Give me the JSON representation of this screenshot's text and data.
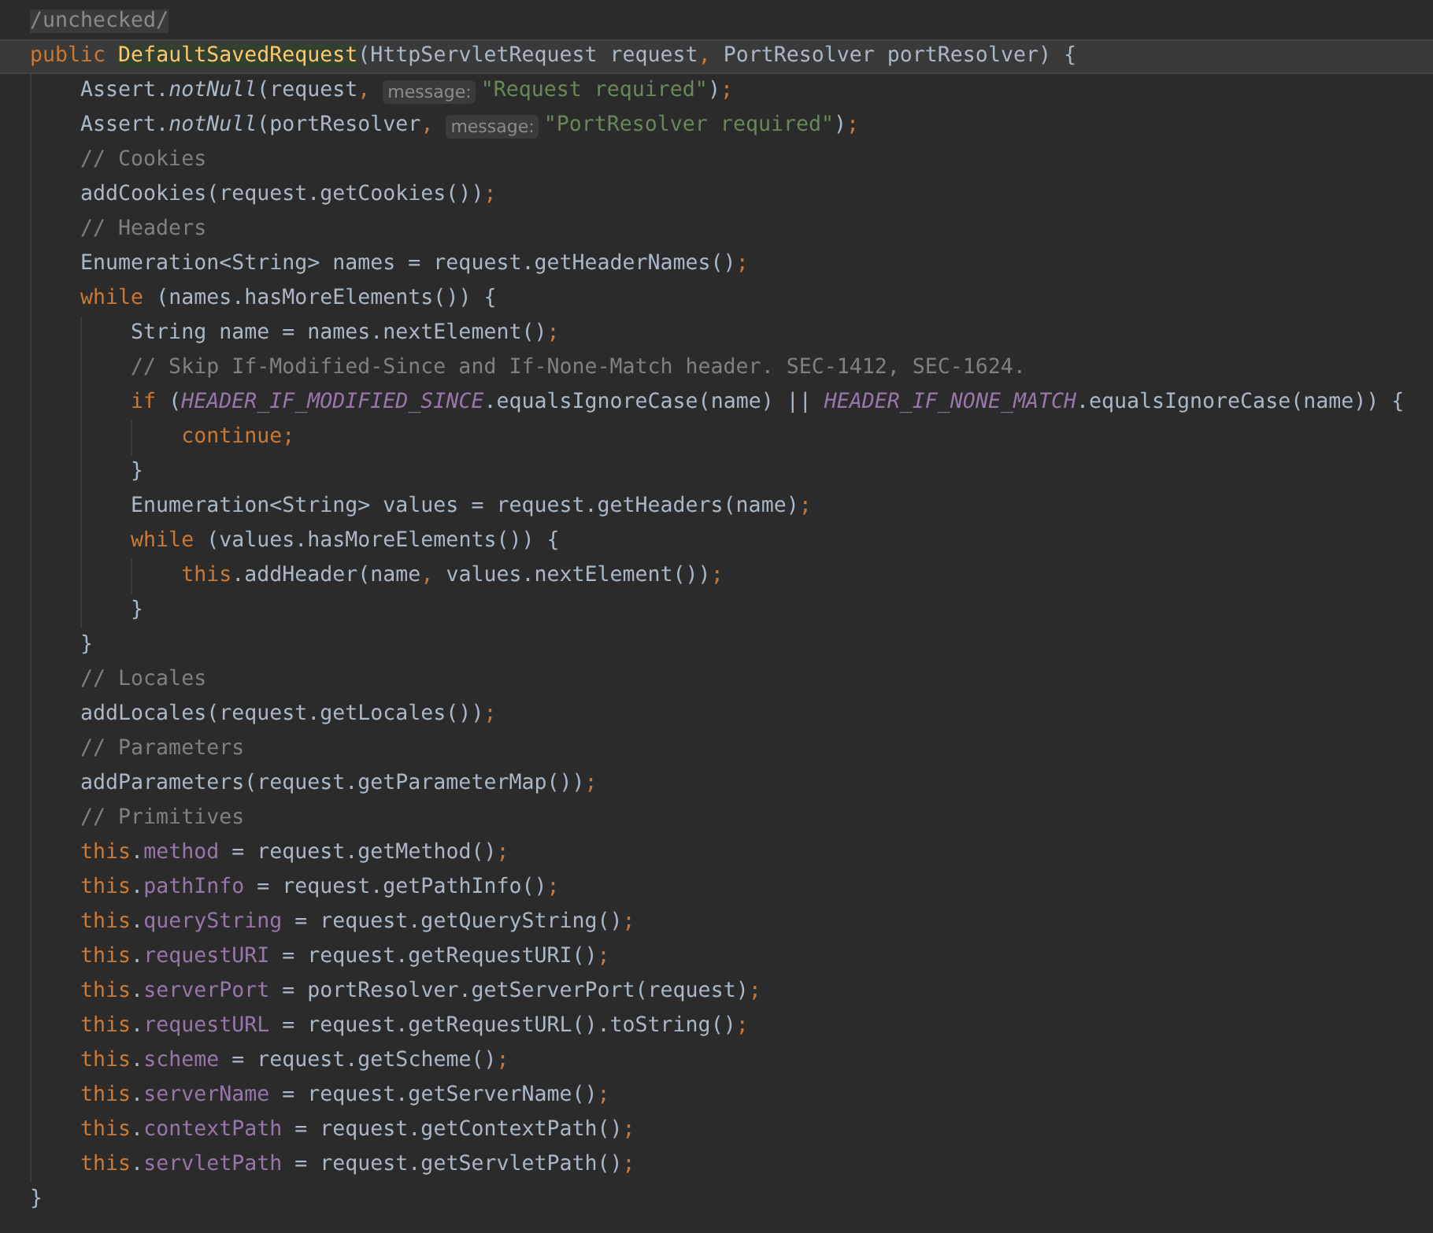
{
  "lines": [
    {
      "current": false,
      "tokens": [
        {
          "kind": "folded",
          "text": "/unchecked/"
        }
      ]
    },
    {
      "current": true,
      "tokens": [
        {
          "kind": "keyword",
          "text": "public "
        },
        {
          "kind": "declaration",
          "text": "DefaultSavedRequest"
        },
        {
          "kind": "plain",
          "text": "(HttpServletRequest request"
        },
        {
          "kind": "punct",
          "text": ", "
        },
        {
          "kind": "plain",
          "text": "PortResolver portResolver) {"
        }
      ]
    },
    {
      "current": false,
      "tokens": [
        {
          "kind": "plain",
          "text": "    Assert."
        },
        {
          "kind": "static_method",
          "text": "notNull"
        },
        {
          "kind": "plain",
          "text": "(request"
        },
        {
          "kind": "punct",
          "text": ", "
        },
        {
          "kind": "hint",
          "text": "message:"
        },
        {
          "kind": "string",
          "text": "\"Request required\""
        },
        {
          "kind": "plain",
          "text": ")"
        },
        {
          "kind": "punct",
          "text": ";"
        }
      ]
    },
    {
      "current": false,
      "tokens": [
        {
          "kind": "plain",
          "text": "    Assert."
        },
        {
          "kind": "static_method",
          "text": "notNull"
        },
        {
          "kind": "plain",
          "text": "(portResolver"
        },
        {
          "kind": "punct",
          "text": ", "
        },
        {
          "kind": "hint",
          "text": "message:"
        },
        {
          "kind": "string",
          "text": "\"PortResolver required\""
        },
        {
          "kind": "plain",
          "text": ")"
        },
        {
          "kind": "punct",
          "text": ";"
        }
      ]
    },
    {
      "current": false,
      "tokens": [
        {
          "kind": "comment",
          "text": "    // Cookies"
        }
      ]
    },
    {
      "current": false,
      "tokens": [
        {
          "kind": "plain",
          "text": "    addCookies(request.getCookies())"
        },
        {
          "kind": "punct",
          "text": ";"
        }
      ]
    },
    {
      "current": false,
      "tokens": [
        {
          "kind": "comment",
          "text": "    // Headers"
        }
      ]
    },
    {
      "current": false,
      "tokens": [
        {
          "kind": "plain",
          "text": "    Enumeration<String> names = request.getHeaderNames()"
        },
        {
          "kind": "punct",
          "text": ";"
        }
      ]
    },
    {
      "current": false,
      "tokens": [
        {
          "kind": "keyword",
          "text": "    while"
        },
        {
          "kind": "plain",
          "text": " (names.hasMoreElements()) {"
        }
      ]
    },
    {
      "current": false,
      "tokens": [
        {
          "kind": "plain",
          "text": "        String name = names.nextElement()"
        },
        {
          "kind": "punct",
          "text": ";"
        }
      ]
    },
    {
      "current": false,
      "tokens": [
        {
          "kind": "comment",
          "text": "        // Skip If-Modified-Since and If-None-Match header. SEC-1412, SEC-1624."
        }
      ]
    },
    {
      "current": false,
      "tokens": [
        {
          "kind": "keyword",
          "text": "        if"
        },
        {
          "kind": "plain",
          "text": " ("
        },
        {
          "kind": "static_field",
          "text": "HEADER_IF_MODIFIED_SINCE"
        },
        {
          "kind": "plain",
          "text": ".equalsIgnoreCase(name) || "
        },
        {
          "kind": "static_field",
          "text": "HEADER_IF_NONE_MATCH"
        },
        {
          "kind": "plain",
          "text": ".equalsIgnoreCase(name)) {"
        }
      ]
    },
    {
      "current": false,
      "tokens": [
        {
          "kind": "keyword",
          "text": "            continue"
        },
        {
          "kind": "punct",
          "text": ";"
        }
      ]
    },
    {
      "current": false,
      "tokens": [
        {
          "kind": "plain",
          "text": "        }"
        }
      ]
    },
    {
      "current": false,
      "tokens": [
        {
          "kind": "plain",
          "text": "        Enumeration<String> values = request.getHeaders(name)"
        },
        {
          "kind": "punct",
          "text": ";"
        }
      ]
    },
    {
      "current": false,
      "tokens": [
        {
          "kind": "keyword",
          "text": "        while"
        },
        {
          "kind": "plain",
          "text": " (values.hasMoreElements()) {"
        }
      ]
    },
    {
      "current": false,
      "tokens": [
        {
          "kind": "keyword",
          "text": "            this"
        },
        {
          "kind": "plain",
          "text": ".addHeader(name"
        },
        {
          "kind": "punct",
          "text": ", "
        },
        {
          "kind": "plain",
          "text": "values.nextElement())"
        },
        {
          "kind": "punct",
          "text": ";"
        }
      ]
    },
    {
      "current": false,
      "tokens": [
        {
          "kind": "plain",
          "text": "        }"
        }
      ]
    },
    {
      "current": false,
      "tokens": [
        {
          "kind": "plain",
          "text": "    }"
        }
      ]
    },
    {
      "current": false,
      "tokens": [
        {
          "kind": "comment",
          "text": "    // Locales"
        }
      ]
    },
    {
      "current": false,
      "tokens": [
        {
          "kind": "plain",
          "text": "    addLocales(request.getLocales())"
        },
        {
          "kind": "punct",
          "text": ";"
        }
      ]
    },
    {
      "current": false,
      "tokens": [
        {
          "kind": "comment",
          "text": "    // Parameters"
        }
      ]
    },
    {
      "current": false,
      "tokens": [
        {
          "kind": "plain",
          "text": "    addParameters(request.getParameterMap())"
        },
        {
          "kind": "punct",
          "text": ";"
        }
      ]
    },
    {
      "current": false,
      "tokens": [
        {
          "kind": "comment",
          "text": "    // Primitives"
        }
      ]
    },
    {
      "current": false,
      "tokens": [
        {
          "kind": "keyword",
          "text": "    this"
        },
        {
          "kind": "plain",
          "text": "."
        },
        {
          "kind": "field",
          "text": "method"
        },
        {
          "kind": "plain",
          "text": " = request.getMethod()"
        },
        {
          "kind": "punct",
          "text": ";"
        }
      ]
    },
    {
      "current": false,
      "tokens": [
        {
          "kind": "keyword",
          "text": "    this"
        },
        {
          "kind": "plain",
          "text": "."
        },
        {
          "kind": "field",
          "text": "pathInfo"
        },
        {
          "kind": "plain",
          "text": " = request.getPathInfo()"
        },
        {
          "kind": "punct",
          "text": ";"
        }
      ]
    },
    {
      "current": false,
      "tokens": [
        {
          "kind": "keyword",
          "text": "    this"
        },
        {
          "kind": "plain",
          "text": "."
        },
        {
          "kind": "field",
          "text": "queryString"
        },
        {
          "kind": "plain",
          "text": " = request.getQueryString()"
        },
        {
          "kind": "punct",
          "text": ";"
        }
      ]
    },
    {
      "current": false,
      "tokens": [
        {
          "kind": "keyword",
          "text": "    this"
        },
        {
          "kind": "plain",
          "text": "."
        },
        {
          "kind": "field",
          "text": "requestURI"
        },
        {
          "kind": "plain",
          "text": " = request.getRequestURI()"
        },
        {
          "kind": "punct",
          "text": ";"
        }
      ]
    },
    {
      "current": false,
      "tokens": [
        {
          "kind": "keyword",
          "text": "    this"
        },
        {
          "kind": "plain",
          "text": "."
        },
        {
          "kind": "field",
          "text": "serverPort"
        },
        {
          "kind": "plain",
          "text": " = portResolver.getServerPort(request)"
        },
        {
          "kind": "punct",
          "text": ";"
        }
      ]
    },
    {
      "current": false,
      "tokens": [
        {
          "kind": "keyword",
          "text": "    this"
        },
        {
          "kind": "plain",
          "text": "."
        },
        {
          "kind": "field",
          "text": "requestURL"
        },
        {
          "kind": "plain",
          "text": " = request.getRequestURL().toString()"
        },
        {
          "kind": "punct",
          "text": ";"
        }
      ]
    },
    {
      "current": false,
      "tokens": [
        {
          "kind": "keyword",
          "text": "    this"
        },
        {
          "kind": "plain",
          "text": "."
        },
        {
          "kind": "field",
          "text": "scheme"
        },
        {
          "kind": "plain",
          "text": " = request.getScheme()"
        },
        {
          "kind": "punct",
          "text": ";"
        }
      ]
    },
    {
      "current": false,
      "tokens": [
        {
          "kind": "keyword",
          "text": "    this"
        },
        {
          "kind": "plain",
          "text": "."
        },
        {
          "kind": "field",
          "text": "serverName"
        },
        {
          "kind": "plain",
          "text": " = request.getServerName()"
        },
        {
          "kind": "punct",
          "text": ";"
        }
      ]
    },
    {
      "current": false,
      "tokens": [
        {
          "kind": "keyword",
          "text": "    this"
        },
        {
          "kind": "plain",
          "text": "."
        },
        {
          "kind": "field",
          "text": "contextPath"
        },
        {
          "kind": "plain",
          "text": " = request.getContextPath()"
        },
        {
          "kind": "punct",
          "text": ";"
        }
      ]
    },
    {
      "current": false,
      "tokens": [
        {
          "kind": "keyword",
          "text": "    this"
        },
        {
          "kind": "plain",
          "text": "."
        },
        {
          "kind": "field",
          "text": "servletPath"
        },
        {
          "kind": "plain",
          "text": " = request.getServletPath()"
        },
        {
          "kind": "punct",
          "text": ";"
        }
      ]
    },
    {
      "current": false,
      "tokens": [
        {
          "kind": "plain",
          "text": "}"
        }
      ]
    }
  ]
}
